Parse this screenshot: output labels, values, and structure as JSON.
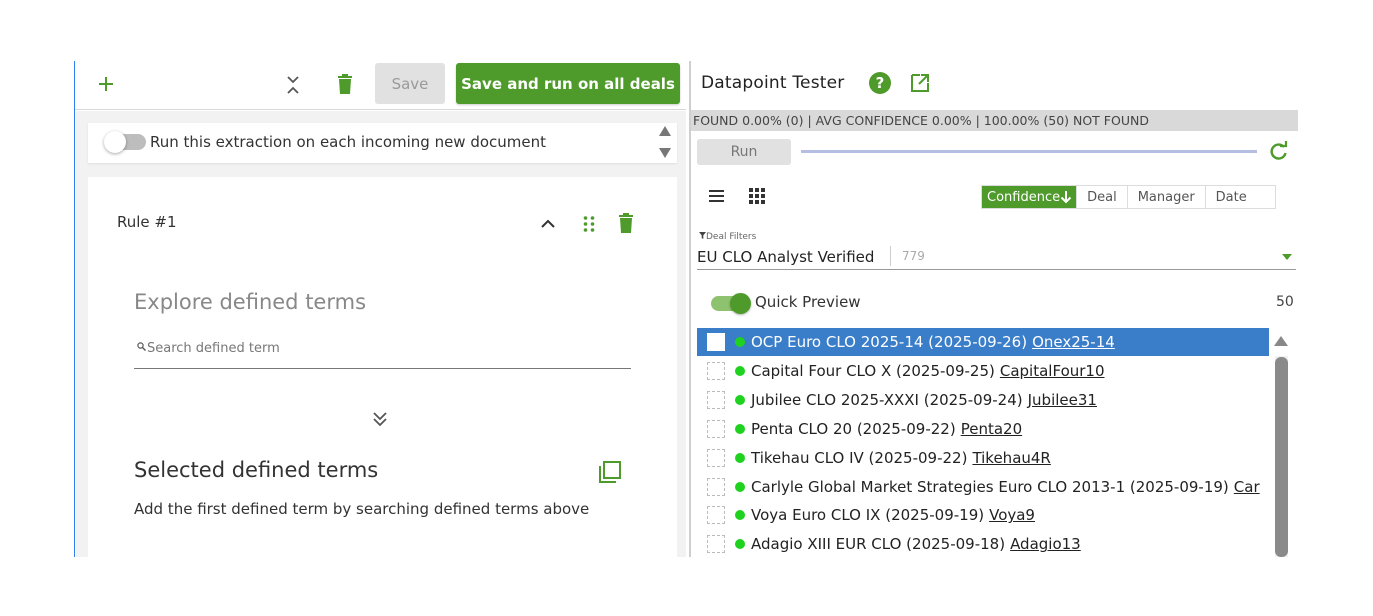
{
  "left_panel": {
    "toolbar": {
      "add_icon": "plus-icon",
      "collapse_icon": "collapse-vertical-icon",
      "delete_icon": "trash-icon",
      "save_label": "Save",
      "save_run_label": "Save and run on all deals"
    },
    "run_toggle": {
      "label": "Run this extraction on each incoming new document",
      "enabled": false
    },
    "rule": {
      "title": "Rule #1",
      "explore_title": "Explore defined terms",
      "search_placeholder": "Search defined term",
      "selected_title": "Selected defined terms",
      "selected_hint": "Add the first defined term by searching defined terms above"
    }
  },
  "right_panel": {
    "title": "Datapoint Tester",
    "stats": "FOUND 0.00% (0) | AVG CONFIDENCE 0.00% | 100.00% (50) NOT FOUND",
    "run_label": "Run",
    "sort_tabs": [
      {
        "label": "Confidence",
        "active": true
      },
      {
        "label": "Deal",
        "active": false
      },
      {
        "label": "Manager",
        "active": false
      },
      {
        "label": "Date",
        "active": false
      }
    ],
    "filters_label": "Deal Filters",
    "filter_value": "EU CLO Analyst Verified",
    "filter_count": "779",
    "quick_preview": {
      "label": "Quick Preview",
      "enabled": true,
      "count": "50"
    },
    "deals": [
      {
        "name": "OCP Euro CLO 2025-14 (2025-09-26)",
        "link": "Onex25-14",
        "selected": true
      },
      {
        "name": "Capital Four CLO X (2025-09-25)",
        "link": "CapitalFour10",
        "selected": false
      },
      {
        "name": "Jubilee CLO 2025-XXXI (2025-09-24)",
        "link": "Jubilee31",
        "selected": false
      },
      {
        "name": "Penta CLO 20 (2025-09-22)",
        "link": "Penta20",
        "selected": false
      },
      {
        "name": "Tikehau CLO IV (2025-09-22)",
        "link": "Tikehau4R",
        "selected": false
      },
      {
        "name": "Carlyle Global Market Strategies Euro CLO 2013-1 (2025-09-19)",
        "link": "Car",
        "selected": false
      },
      {
        "name": "Voya Euro CLO IX (2025-09-19)",
        "link": "Voya9",
        "selected": false
      },
      {
        "name": "Adagio XIII EUR CLO (2025-09-18)",
        "link": "Adagio13",
        "selected": false
      }
    ]
  },
  "colors": {
    "accent": "#4e9a2a",
    "selected_row": "#3a7dc9",
    "status_dot": "#1fd21f"
  }
}
